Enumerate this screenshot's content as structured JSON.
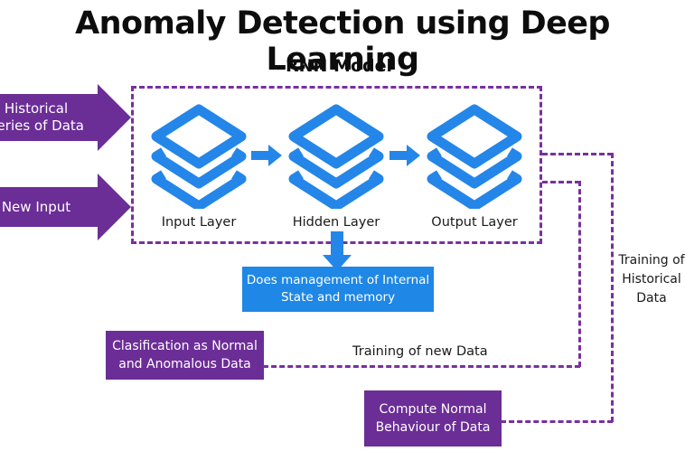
{
  "page": {
    "title": "Anomaly Detection using Deep Learning",
    "subtitle": "RNN Model"
  },
  "colors": {
    "purple": "#6B2D96",
    "purple_dash": "#7A2FA0",
    "blue": "#1F87E5",
    "text_dark": "#1A1A1A",
    "background": "#FFFFFF"
  },
  "inputs": [
    {
      "id": "historical",
      "label": "Historical\nSeries of Data",
      "line1": "Historical",
      "line2": "Series of Data"
    },
    {
      "id": "new_input",
      "label": "New Input",
      "line1": "New Input",
      "line2": ""
    }
  ],
  "rnn_model": {
    "container_label": "RNN Model",
    "layers": [
      {
        "id": "input",
        "label": "Input Layer",
        "icon": "layers-stack-icon"
      },
      {
        "id": "hidden",
        "label": "Hidden Layer",
        "icon": "layers-stack-icon"
      },
      {
        "id": "output",
        "label": "Output Layer",
        "icon": "layers-stack-icon"
      }
    ],
    "flow_arrows": [
      {
        "id": "input-to-hidden",
        "icon": "arrow-right-icon"
      },
      {
        "id": "hidden-to-output",
        "icon": "arrow-right-icon"
      },
      {
        "id": "hidden-to-memory",
        "icon": "arrow-down-icon"
      }
    ]
  },
  "memory_box": {
    "line1": "Does management of Internal",
    "line2": "State and memory"
  },
  "output_boxes": [
    {
      "id": "classification",
      "line1": "Clasification as Normal",
      "line2": "and Anomalous Data"
    },
    {
      "id": "compute_normal",
      "line1": "Compute Normal",
      "line2": "Behaviour of Data"
    }
  ],
  "connector_labels": [
    {
      "id": "training_new_data",
      "text": "Training of new Data"
    },
    {
      "id": "training_historical_data",
      "line1": "Training of",
      "line2": "Historical",
      "line3": "Data"
    }
  ]
}
